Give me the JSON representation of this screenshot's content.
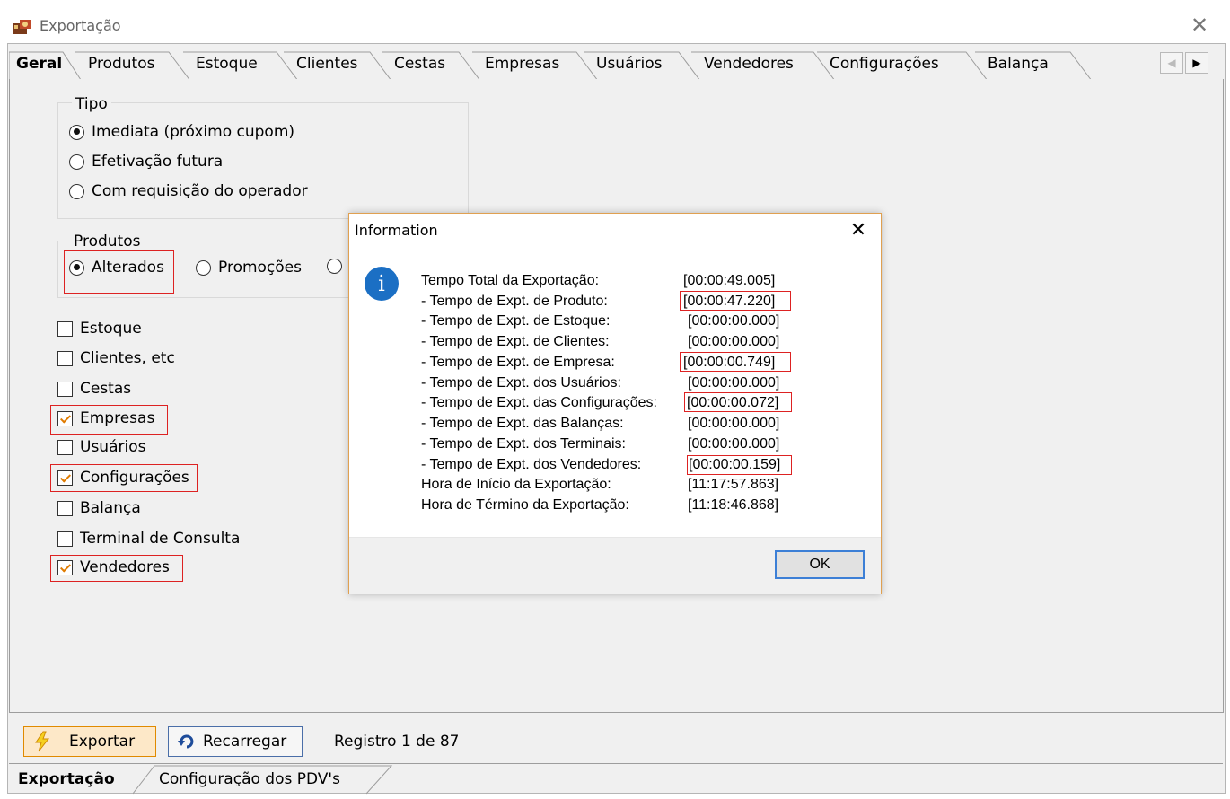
{
  "window": {
    "title": "Exportação",
    "close_glyph": "✕",
    "icon": "app-icon"
  },
  "tabs": [
    {
      "label": "Geral",
      "active": true
    },
    {
      "label": "Produtos"
    },
    {
      "label": "Estoque"
    },
    {
      "label": "Clientes"
    },
    {
      "label": "Cestas"
    },
    {
      "label": "Empresas"
    },
    {
      "label": "Usuários"
    },
    {
      "label": "Vendedores"
    },
    {
      "label": "Configurações"
    },
    {
      "label": "Balança"
    }
  ],
  "tipo": {
    "legend": "Tipo",
    "options": [
      {
        "label": "Imediata (próximo cupom)",
        "selected": true
      },
      {
        "label": "Efetivação futura",
        "selected": false
      },
      {
        "label": "Com requisição do operador",
        "selected": false
      }
    ]
  },
  "produtos": {
    "legend": "Produtos",
    "options": [
      {
        "label": "Alterados",
        "selected": true
      },
      {
        "label": "Promoções",
        "selected": false
      }
    ]
  },
  "checkboxes": [
    {
      "label": "Estoque",
      "checked": false
    },
    {
      "label": "Clientes, etc",
      "checked": false
    },
    {
      "label": "Cestas",
      "checked": false
    },
    {
      "label": "Empresas",
      "checked": true
    },
    {
      "label": "Usuários",
      "checked": false
    },
    {
      "label": "Configurações",
      "checked": true
    },
    {
      "label": "Balança",
      "checked": false
    },
    {
      "label": "Terminal de Consulta",
      "checked": false
    },
    {
      "label": "Vendedores",
      "checked": true
    }
  ],
  "dialog": {
    "title": "Information",
    "close_glyph": "✕",
    "icon": "info-icon",
    "icon_glyph": "i",
    "rows": [
      {
        "label": "Tempo Total da Exportação:",
        "value": "[00:00:49.005]"
      },
      {
        "label": "- Tempo de Expt. de Produto:",
        "value": "[00:00:47.220]"
      },
      {
        "label": "- Tempo de Expt. de Estoque:",
        "value": "[00:00:00.000]"
      },
      {
        "label": "- Tempo de Expt. de Clientes:",
        "value": "[00:00:00.000]"
      },
      {
        "label": "- Tempo de Expt. de Empresa:",
        "value": "[00:00:00.749]"
      },
      {
        "label": "- Tempo de Expt. dos Usuários:",
        "value": "[00:00:00.000]"
      },
      {
        "label": "- Tempo de Expt. das Configurações:",
        "value": "[00:00:00.072]"
      },
      {
        "label": "- Tempo de Expt. das Balanças:",
        "value": "[00:00:00.000]"
      },
      {
        "label": "- Tempo de Expt. dos Terminais:",
        "value": "[00:00:00.000]"
      },
      {
        "label": "- Tempo de Expt. dos Vendedores:",
        "value": "[00:00:00.159]"
      },
      {
        "label": "Hora de Início da Exportação:",
        "value": "[11:17:57.863]"
      },
      {
        "label": "Hora de Término da Exportação:",
        "value": "[11:18:46.868]"
      }
    ],
    "ok_label": "OK"
  },
  "toolbar": {
    "export_label": "Exportar",
    "export_icon": "lightning-icon",
    "reload_label": "Recarregar",
    "reload_icon": "reload-icon",
    "status": "Registro 1 de 87"
  },
  "bottom_tabs": [
    {
      "label": "Exportação",
      "active": true
    },
    {
      "label": "Configuração dos PDV's"
    }
  ],
  "colors": {
    "highlight": "#dd2222",
    "accent": "#1b6fc4",
    "checkmark": "#e07b00"
  }
}
